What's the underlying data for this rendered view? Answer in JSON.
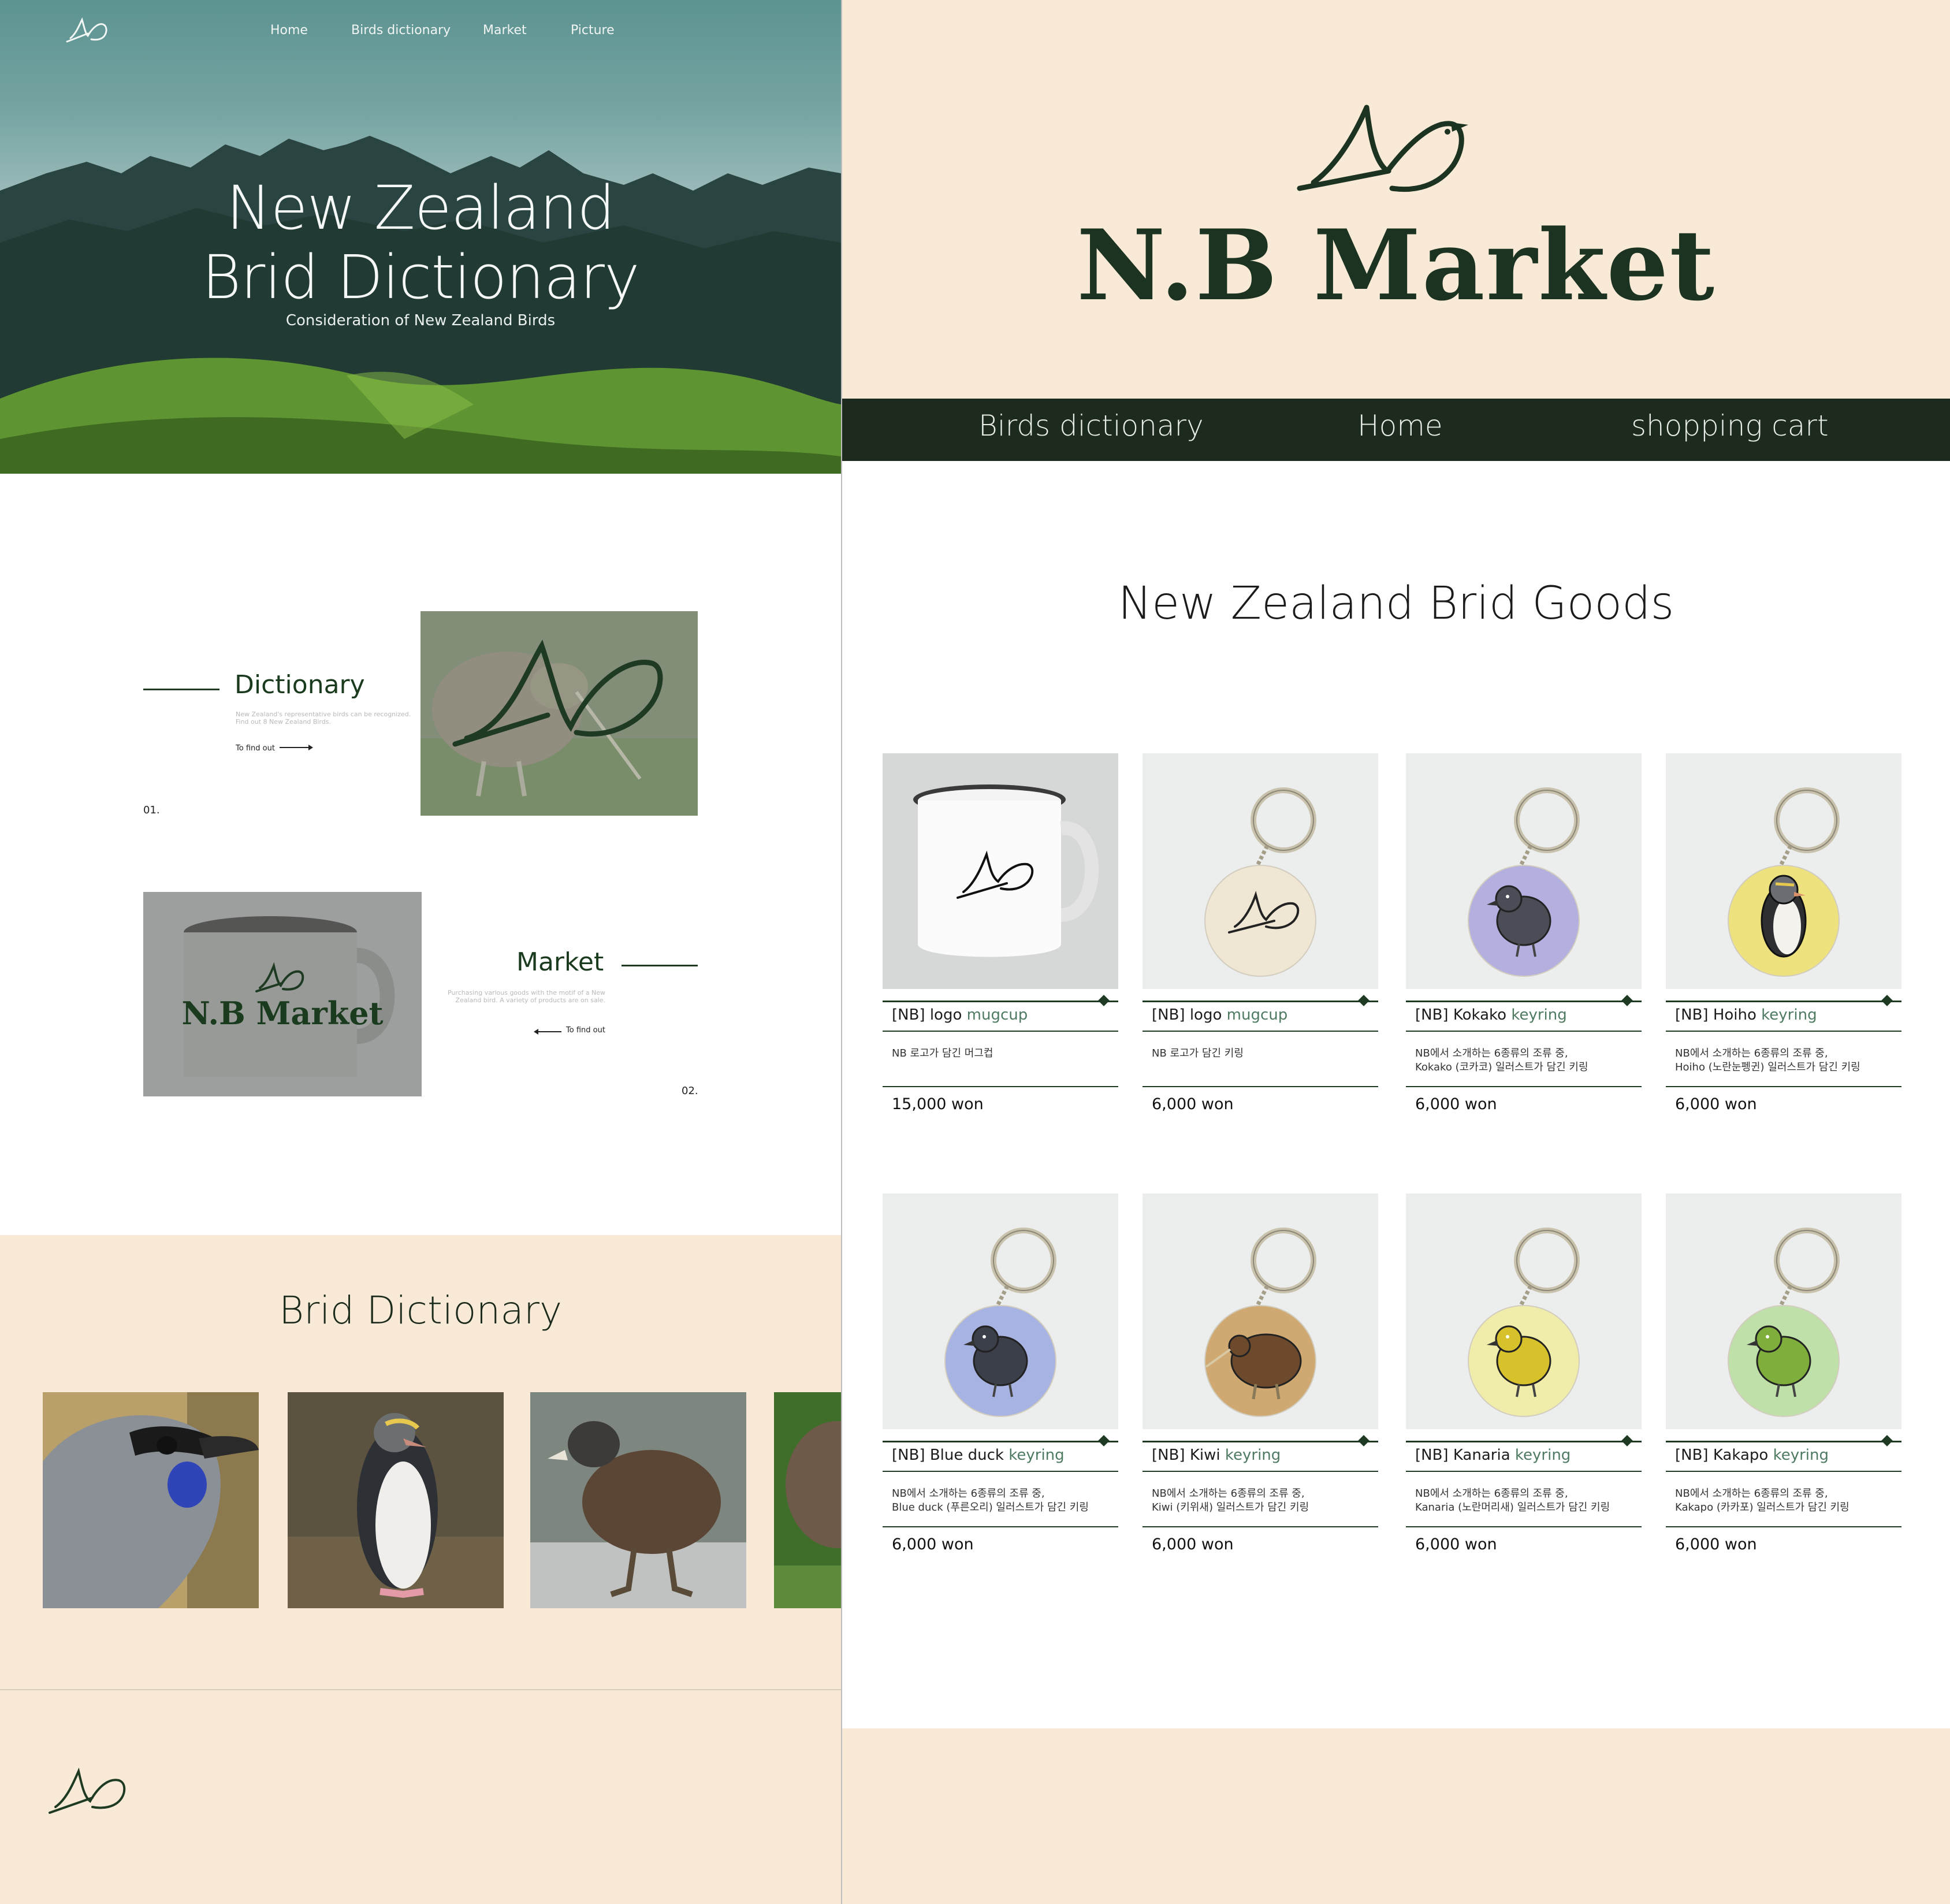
{
  "left": {
    "nav": [
      "Home",
      "Birds dictionary",
      "Market",
      "Picture"
    ],
    "hero": {
      "title_line1": "New Zealand",
      "title_line2": "Brid Dictionary",
      "subtitle": "Consideration of New Zealand Birds"
    },
    "section1": {
      "title": "Dictionary",
      "desc": "New Zealand's representative birds can be recognized. Find out 8 New Zealand Birds.",
      "link": "To find out",
      "number": "01."
    },
    "section2": {
      "title": "Market",
      "desc": "Purchasing various goods with the motif of a New Zealand bird. A variety of products are on sale.",
      "link": "To find out",
      "number": "02.",
      "image_brand": "N.B Market"
    },
    "band": {
      "title": "Brid Dictionary"
    }
  },
  "right": {
    "brand": "N.B Market",
    "nav": [
      "Birds dictionary",
      "Home",
      "shopping cart"
    ],
    "title": "New Zealand Brid Goods",
    "products": [
      {
        "prefix": "[NB] logo",
        "type": "mugcup",
        "desc": "NB 로고가 담긴 머그컵",
        "price": "15,000 won",
        "art": "mug"
      },
      {
        "prefix": "[NB] logo",
        "type": "mugcup",
        "desc": "NB 로고가 담긴 키링",
        "price": "6,000 won",
        "art": "logo",
        "disc": "#efe6d3"
      },
      {
        "prefix": "[NB] Kokako",
        "type": "keyring",
        "desc": "NB에서 소개하는 6종류의 조류 중,\nKokako (코카코) 일러스트가 담긴 키링",
        "price": "6,000 won",
        "art": "bird",
        "disc": "#b3b0e0",
        "bird": "#4a4d55"
      },
      {
        "prefix": "[NB] Hoiho",
        "type": "keyring",
        "desc": "NB에서 소개하는 6종류의 조류 중,\nHoiho (노란눈펭귄) 일러스트가 담긴 키링",
        "price": "6,000 won",
        "art": "penguin",
        "disc": "#ede27d"
      },
      {
        "prefix": "[NB] Blue duck",
        "type": "keyring",
        "desc": "NB에서 소개하는 6종류의 조류 중,\nBlue duck (푸른오리) 일러스트가 담긴 키링",
        "price": "6,000 won",
        "art": "bird",
        "disc": "#a7b3e2",
        "bird": "#3b3f4a"
      },
      {
        "prefix": "[NB] Kiwi",
        "type": "keyring",
        "desc": "NB에서 소개하는 6종류의 조류 중,\nKiwi (키위새) 일러스트가 담긴 키링",
        "price": "6,000 won",
        "art": "kiwi",
        "disc": "#cfa971"
      },
      {
        "prefix": "[NB] Kanaria",
        "type": "keyring",
        "desc": "NB에서 소개하는 6종류의 조류 중,\nKanaria (노란머리새) 일러스트가 담긴 키링",
        "price": "6,000 won",
        "art": "bird",
        "disc": "#f0ecaa",
        "bird": "#d8c22c"
      },
      {
        "prefix": "[NB] Kakapo",
        "type": "keyring",
        "desc": "NB에서 소개하는 6종류의 조류 중,\nKakapo (카카포) 일러스트가 담긴 키링",
        "price": "6,000 won",
        "art": "bird",
        "disc": "#bfe0a8",
        "bird": "#7fae3c"
      }
    ]
  },
  "colors": {
    "brand_green": "#1c2b1e",
    "cream": "#f8ead6",
    "accent_text": "#4f7a62"
  }
}
